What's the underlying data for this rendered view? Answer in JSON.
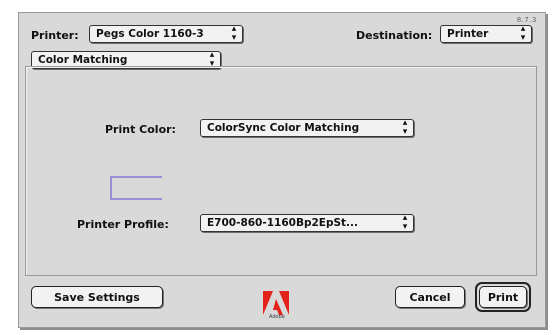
{
  "dialog": {
    "version": "8.7.3",
    "printer_label": "Printer:",
    "printer_value": "Pegs Color 1160-3",
    "destination_label": "Destination:",
    "destination_value": "Printer",
    "panel_value": "Color Matching"
  },
  "color_matching": {
    "print_color_label": "Print Color:",
    "print_color_value": "ColorSync Color Matching",
    "printer_profile_label": "Printer Profile:",
    "printer_profile_value": "E700-860-1160Bp2EpSt...",
    "swatch_color": "#9c8ed8"
  },
  "footer": {
    "save_settings": "Save Settings",
    "cancel": "Cancel",
    "print": "Print",
    "logo_text": "Adobe"
  },
  "icons": {
    "popup_arrow": "up-down-arrows-icon",
    "logo": "adobe-logo-icon"
  },
  "colors": {
    "dialog_bg": "#d9d9d9",
    "logo_red": "#e2231a"
  }
}
